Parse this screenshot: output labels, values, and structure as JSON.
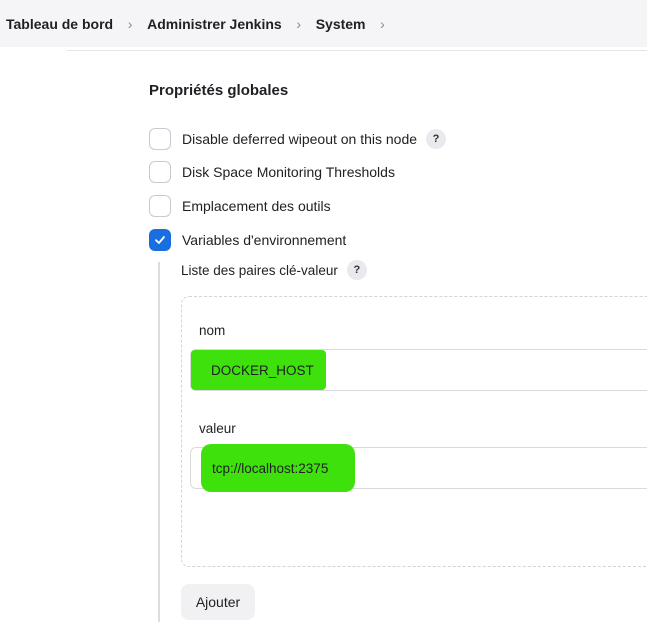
{
  "breadcrumb": {
    "items": [
      "Tableau de bord",
      "Administrer Jenkins",
      "System"
    ],
    "separator": ">"
  },
  "section": {
    "title": "Propriétés globales"
  },
  "options": [
    {
      "label": "Disable deferred wipeout on this node",
      "checked": false,
      "has_help": true
    },
    {
      "label": "Disk Space Monitoring Thresholds",
      "checked": false,
      "has_help": false
    },
    {
      "label": "Emplacement des outils",
      "checked": false,
      "has_help": false
    },
    {
      "label": "Variables d'environnement",
      "checked": true,
      "has_help": false
    }
  ],
  "help_glyph": "?",
  "env_vars": {
    "list_label": "Liste des paires clé-valeur",
    "name_label": "nom",
    "name_value": "DOCKER_HOST",
    "value_label": "valeur",
    "value_value": "tcp://localhost:2375",
    "add_label": "Ajouter"
  },
  "colors": {
    "accent": "#1a6fe0",
    "highlight": "#3ee10c"
  }
}
